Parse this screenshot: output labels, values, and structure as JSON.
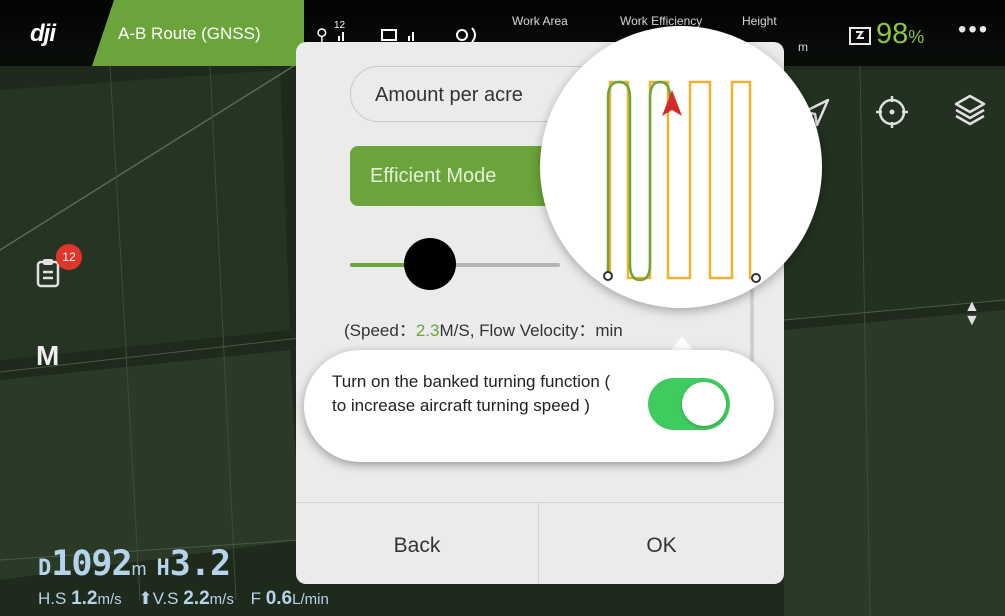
{
  "top_bar": {
    "route_mode": "A-B Route (GNSS)",
    "signal_count": "12",
    "work_area_label": "Work Area",
    "work_efficiency_label": "Work Efficiency",
    "height_label": "Height",
    "height_unit": "m",
    "battery_percent": "98",
    "battery_unit": "%"
  },
  "left_panel": {
    "notification_count": "12",
    "flight_mode": "M"
  },
  "dialog": {
    "amount_select": "Amount per acre",
    "mode_button": "Efficient Mode",
    "slider_level": 0.45,
    "speed_prefix": "(Speed：",
    "speed_value": "2.3",
    "speed_suffix": "M/S,  Flow Velocity：",
    "flow_tail": "min",
    "back_label": "Back",
    "ok_label": "OK"
  },
  "callout": {
    "text": "Turn on the banked turning function ( to increase aircraft turning speed )",
    "toggle_on": true
  },
  "telemetry": {
    "d_prefix": "D",
    "distance": "1092",
    "distance_unit": "m",
    "h_prefix": "H",
    "height": "3.2",
    "hs_label": "H.S",
    "hs_value": "1.2",
    "hs_unit": "m/s",
    "vs_label": "V.S",
    "vs_value": "2.2",
    "vs_unit": "m/s",
    "f_label": "F",
    "f_value": "0.6",
    "f_unit": "L/min"
  },
  "colors": {
    "accent_green": "#6aa43a",
    "toggle_green": "#3fcb5e",
    "battery_green": "#8dc63f",
    "route_orange": "#f0b030",
    "badge_red": "#e0352b"
  }
}
